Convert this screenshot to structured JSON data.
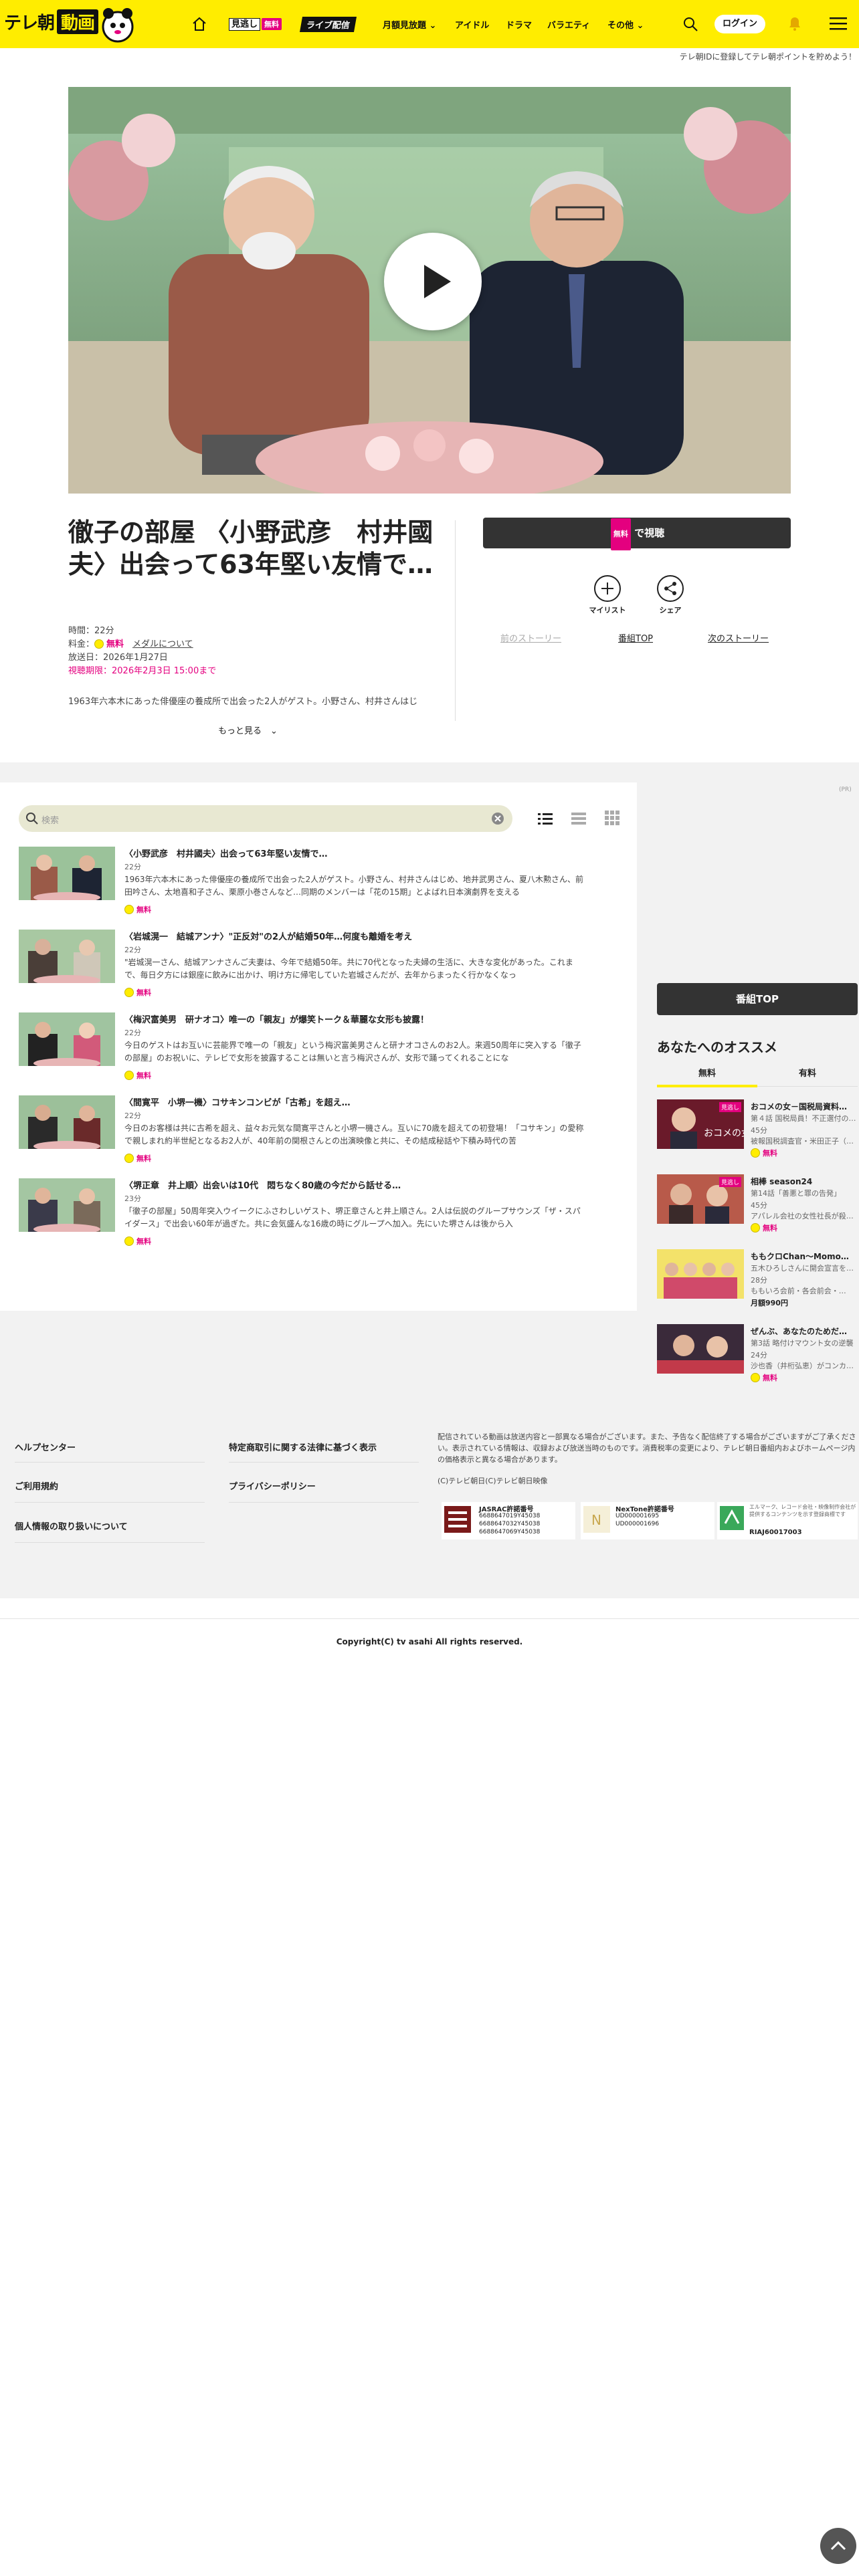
{
  "header": {
    "logo_text": "テレ朝",
    "logo_box": "動画",
    "nav": {
      "mitai": "見逃し",
      "free": "無料",
      "live": "ライブ配信",
      "monthly": "月額見放題",
      "idol": "アイドル",
      "drama": "ドラマ",
      "variety": "バラエティ",
      "other": "その他"
    },
    "login": "ログイン",
    "subnote": "テレ朝IDに登録してテレ朝ポイントを貯めよう！"
  },
  "episode": {
    "title": "徹子の部屋 〈小野武彦　村井國夫〉出会って63年堅い友情で…",
    "duration": "時間：22分",
    "price_label": "料金：",
    "price_free": "無料",
    "media_link": "メダルについて",
    "aired": "放送日：2026年1月27日",
    "deadline": "視聴期限：2026年2月3日 15:00まで",
    "desc": "1963年六本木にあった俳優座の養成所で出会った2人がゲスト。小野さん、村井さんはじ",
    "more": "もっと見る",
    "watch_badge": "無料",
    "watch_label": "で視聴",
    "mylist": "マイリスト",
    "share": "シェア",
    "prev_story": "前のストーリー",
    "program_top": "番組TOP",
    "next_story": "次のストーリー"
  },
  "list": {
    "search_placeholder": "検索",
    "items": [
      {
        "title": "〈小野武彦　村井國夫〉出会って63年堅い友情で…",
        "dur": "22分",
        "desc": "1963年六本木にあった俳優座の養成所で出会った2人がゲスト。小野さん、村井さんはじめ、地井武男さん、夏八木勲さん、前田吟さん、太地喜和子さん、栗原小巻さんなど…同期のメンバーは「花の15期」とよばれ日本演劇界を支える",
        "free": "無料"
      },
      {
        "title": "〈岩城滉一　結城アンナ〉\"正反対\"の2人が結婚50年…何度も離婚を考え",
        "dur": "22分",
        "desc": "\"岩城滉一さん、結城アンナさんご夫妻は、今年で結婚50年。共に70代となった夫婦の生活に、大きな変化があった。これまで、毎日夕方には銀座に飲みに出かけ、明け方に帰宅していた岩城さんだが、去年からまったく行かなくなっ",
        "free": "無料"
      },
      {
        "title": "〈梅沢富美男　研ナオコ〉唯一の「親友」が爆笑トーク＆華麗な女形も披露！",
        "dur": "22分",
        "desc": "今日のゲストはお互いに芸能界で唯一の「親友」という梅沢富美男さんと研ナオコさんのお2人。来週50周年に突入する「徹子の部屋」のお祝いに、テレビで女形を披露することは無いと言う梅沢さんが、女形で踊ってくれることにな",
        "free": "無料"
      },
      {
        "title": "〈間寛平　小堺一機〉コサキンコンビが「古希」を超え…",
        "dur": "22分",
        "desc": "今日のお客様は共に古希を超え、益々お元気な間寛平さんと小堺一機さん。互いに70歳を超えての初登場！「コサキン」の愛称で親しまれ約半世紀となるお2人が、40年前の関根さんとの出演映像と共に、その結成秘話や下積み時代の苦",
        "free": "無料"
      },
      {
        "title": "〈堺正章　井上順〉出会いは10代　悶ちなく80歳の今だから話せる…",
        "dur": "23分",
        "desc": "「徹子の部屋」50周年突入ウイークにふさわしいゲスト、堺正章さんと井上順さん。2人は伝説のグループサウンズ「ザ・スパイダース」で出会い60年が過ぎた。共に会気盛んな16歳の時にグループへ加入。先にいた堺さんは後から入",
        "free": "無料"
      }
    ]
  },
  "sidebar": {
    "pr": "(PR)",
    "program_top": "番組TOP",
    "reco_title": "あなたへのオススメ",
    "tabs": {
      "free": "無料",
      "paid": "有料"
    },
    "items": [
      {
        "tag": "見逃し",
        "title": "おコメの女－国税局資料…",
        "sub": "第４話 国税局員！不正選付の…",
        "dur": "45分",
        "sub2": "被報国税調査官・米田正子（…",
        "free": "無料"
      },
      {
        "tag": "見逃し",
        "title": "相棒 season24",
        "sub": "第14話「善悪と罪の告発」",
        "dur": "45分",
        "sub2": "アパレル会社の女性社長が殺…",
        "free": "無料"
      },
      {
        "tag": "",
        "title": "ももクロChan～Momo…",
        "sub": "五木ひろしさんに開会宣言を…",
        "dur": "28分",
        "sub2": "ももいろ会前・各会前会・…",
        "free": "月額990円"
      },
      {
        "tag": "",
        "title": "ぜんぶ、あなたのためだ…",
        "sub": "第3話 略付けマウント女の逆襲",
        "dur": "24分",
        "sub2": "沙也香（井桁弘恵）がコンカ…",
        "free": "無料"
      }
    ]
  },
  "footer": {
    "links": [
      "ヘルプセンター",
      "ご利用規約",
      "個人情報の取り扱いについて"
    ],
    "links2": [
      "特定商取引に関する法律に基づく表示",
      "プライバシーポリシー"
    ],
    "note": "配信されている動画は放送内容と一部異なる場合がございます。また、予告なく配信終了する場合がございますがご了承ください。表示されている情報は、収録および放送当時のものです。消費税率の変更により、テレビ朝日番組内およびホームページ内の価格表示と異なる場合があります。",
    "credit": "(C)テレビ朝日(C)テレビ朝日映像",
    "jasrac_title": "JASRAC許諾番号",
    "jasrac_nums": [
      "6688647019Y45038",
      "6688647032Y45038",
      "6688647069Y45038"
    ],
    "nextone_title": "NexTone許諾番号",
    "nextone_nums": [
      "UD000001695",
      "UD000001696"
    ],
    "record_text": "エルマーク、レコード会社・映像制作会社が提供するコンテンツを示す登録商標です",
    "record_num": "RIAJ60017003",
    "copyright": "Copyright(C) tv asahi All rights reserved."
  }
}
